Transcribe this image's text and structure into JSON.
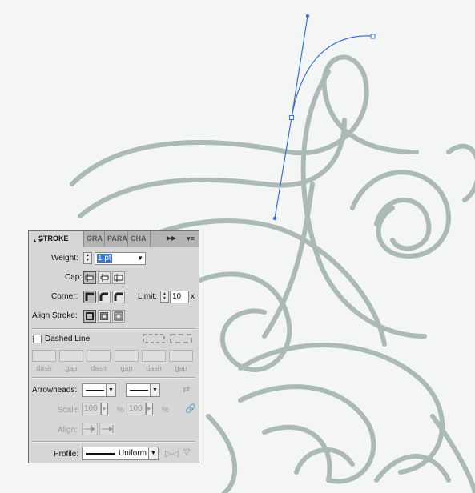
{
  "panel": {
    "tabs": [
      {
        "label": "STROKE",
        "active": true
      },
      {
        "label": "GRA",
        "active": false
      },
      {
        "label": "PARA",
        "active": false
      },
      {
        "label": "CHA",
        "active": false
      }
    ],
    "weight": {
      "label": "Weight:",
      "value": "1 pt"
    },
    "cap": {
      "label": "Cap:",
      "selected": "butt"
    },
    "corner": {
      "label": "Corner:",
      "selected": "miter"
    },
    "limit": {
      "label": "Limit:",
      "value": "10",
      "unit": "x"
    },
    "align_stroke": {
      "label": "Align Stroke:",
      "selected": "center"
    },
    "dashed_line": {
      "label": "Dashed Line",
      "checked": false
    },
    "dash_gap_labels": [
      "dash",
      "gap",
      "dash",
      "gap",
      "dash",
      "gap"
    ],
    "arrowheads": {
      "label": "Arrowheads:"
    },
    "scale": {
      "label": "Scale:",
      "start": "100",
      "end": "100",
      "unit": "%"
    },
    "align": {
      "label": "Align:"
    },
    "profile": {
      "label": "Profile:",
      "value": "Uniform"
    }
  },
  "colors": {
    "path_blue": "#3a6fd8",
    "sketch_gray": "#9fb0ad",
    "panel_bg": "#d6d6d6"
  }
}
